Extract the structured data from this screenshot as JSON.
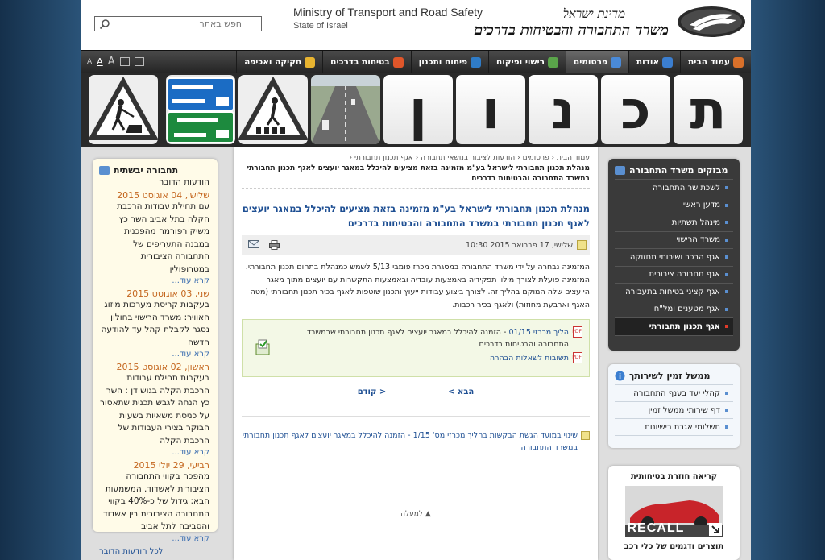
{
  "header": {
    "ministry_he_small": "מדינת ישראל",
    "ministry_he": "משרד התחבורה והבטיחות בדרכים",
    "ministry_en": "Ministry of Transport and Road Safety",
    "state_en": "State of Israel",
    "search_placeholder": "חפש באתר"
  },
  "nav": {
    "items": [
      {
        "label": "עמוד הבית",
        "icon": "home-icon",
        "color": "#d9702a"
      },
      {
        "label": "אודות",
        "icon": "info-icon",
        "color": "#3b7ed0"
      },
      {
        "label": "פרסומים",
        "icon": "publications-icon",
        "color": "#4a8ad8",
        "active": true
      },
      {
        "label": "רישוי ופיקוח",
        "icon": "licensing-icon",
        "color": "#5aa44a"
      },
      {
        "label": "פיתוח ותכנון",
        "icon": "globe-icon",
        "color": "#2f7cc8"
      },
      {
        "label": "בטיחות בדרכים",
        "icon": "lifebuoy-icon",
        "color": "#e0562a"
      },
      {
        "label": "חקיקה ואכיפה",
        "icon": "folder-icon",
        "color": "#e8b430"
      }
    ],
    "font_tools": [
      "A",
      "A",
      "A"
    ]
  },
  "banner": {
    "letters": [
      "ת",
      "כ",
      "נ",
      "ו",
      "ן"
    ]
  },
  "left": {
    "title": "תחבורה יבשתית",
    "subtitle": "הודעות הדובר",
    "news": [
      {
        "date": "שלישי, 04 אוגוסט 2015",
        "text": "עם תחילת עבודות הרכבת הקלה בתל אביב השר כץ משיק רפורמה מהפכנית במבנה התעריפים של התחבורה הציבורית במטרופולין",
        "more": "קרא עוד..."
      },
      {
        "date": "שני, 03 אוגוסט 2015",
        "text": "בעקבות קריסת מערכות מיזוג האוויר: משרד הרישוי בחולון נסגר לקבלת קהל עד להודעה חדשה",
        "more": "קרא עוד..."
      },
      {
        "date": "ראשון, 02 אוגוסט 2015",
        "text": "בעקבות תחילת עבודות הרכבת הקלה בגוש דן : השר כץ הנחה לגבש תכנית שתאסור על כניסת משאיות בשעות הבוקר בצירי העבודות של הרכבת הקלה",
        "more": "קרא עוד..."
      },
      {
        "date": "רביעי, 29 יולי 2015",
        "text": "מהפכה בקווי התחבורה הציבורית לאשדוד. המשמעות הבא: גידול של כ-40% בקווי התחבורה הציבורית בין אשדוד והסביבה לתל אביב",
        "more": "קרא עוד..."
      }
    ],
    "all_link": "לכל הודעות הדובר"
  },
  "center": {
    "breadcrumb": [
      "עמוד הבית",
      "פרסומים",
      "הודעות לציבור בנושאי תחבורה",
      "אגף תכנון תחבורתי"
    ],
    "breadcrumb_current": "מנהלת תכנון תחבורתי לישראל בע\"מ מזמינה בזאת מציעים להיכלל במאגר יועצים לאגף תכנון תחבורתי במשרד התחבורה והבטיחות בדרכים",
    "title": "מנהלת תכנון תחבורתי לישראל בע\"מ מזמינה בזאת מציעים להיכלל במאגר יועצים לאגף תכנון תחבורתי במשרד התחבורה והבטיחות בדרכים",
    "date": "שלישי, 17 פברואר 2015 10:30",
    "body": [
      "המזמינה נבחרה על ידי משרד התחבורה במסגרת מכרז פומבי 5/13 לשמש כמנהלת בתחום תכנון תחבורתי.",
      "המזמינה פועלת לצורך מילוי תפקידיה באמצעות עובדיה ובאמצעות התקשרות עם יועצים מתוך מאגר היועצים שלה המוקם בהליך זה. לצורך ביצוע עבודות ייעוץ ותכנון שוטפות לאגף בכיר תכנון תחבורתי (מטה האגף וארבעת מחוזות) ולאגף בכיר רכבות."
    ],
    "attachments": [
      {
        "label": "הליך מכרזי 01/15",
        "desc": " - הזמנה להיכלל במאגר יועצים לאגף תכנון תחבורתי שבמשרד התחבורה והבטיחות בדרכים"
      },
      {
        "label": "תשובות לשאלות הבהרה",
        "desc": ""
      }
    ],
    "prev": "< קודם",
    "next": "הבא >",
    "related": "שינוי במועד הגשת הבקשות בהליך מכרזי מס' 1/15 - הזמנה להיכלל במאגר יועצים לאגף תכנון תחבורתי במשרד התחבורה",
    "top": "למעלה"
  },
  "right": {
    "menu_title": "מבזקים משרד התחבורה",
    "menu": [
      {
        "label": "לשכת שר התחבורה"
      },
      {
        "label": "מדען ראשי"
      },
      {
        "label": "מינהל תשתיות"
      },
      {
        "label": "משרד הרישוי"
      },
      {
        "label": "אגף הרכב ושירותי תחזוקה"
      },
      {
        "label": "אגף תחבורה ציבורית"
      },
      {
        "label": "אגף קציני בטיחות בתעבורה"
      },
      {
        "label": "אגף מטענים ומל\"ח"
      },
      {
        "label": "אגף תכנון תחבורתי",
        "active": true
      }
    ],
    "services_title": "ממשל זמין לשירותך",
    "services": [
      "קהלי יעד בענף התחבורה",
      "דף שירותי ממשל זמין",
      "תשלומי אגרת רישיונות"
    ],
    "recall_title": "קריאה חוזרת בטיחותית",
    "recall_label": "RECALL",
    "recall_caption": "תוצרים ודגמים של כלי רכב"
  },
  "colors": {
    "accent_blue": "#1e4f93",
    "date_orange": "#c4661e",
    "nav_dark": "#2f2f2f"
  }
}
